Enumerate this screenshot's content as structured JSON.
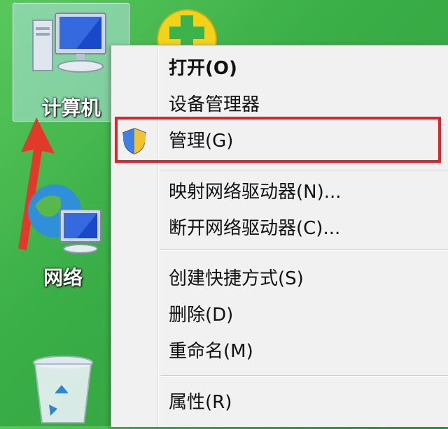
{
  "desktop": {
    "icons": [
      {
        "label": "计算机",
        "icon": "computer-icon"
      },
      {
        "label": "网络",
        "icon": "network-icon"
      },
      {
        "label": "",
        "icon": "recycle-bin-icon"
      }
    ]
  },
  "context_menu": {
    "items": [
      {
        "label": "打开(O)",
        "bold": true
      },
      {
        "label": "设备管理器"
      },
      {
        "label": "管理(G)",
        "icon": "uac-shield-icon",
        "highlighted": true
      },
      {
        "label": "映射网络驱动器(N)..."
      },
      {
        "label": "断开网络驱动器(C)..."
      },
      {
        "label": "创建快捷方式(S)"
      },
      {
        "label": "删除(D)"
      },
      {
        "label": "重命名(M)"
      },
      {
        "label": "属性(R)"
      }
    ]
  },
  "colors": {
    "desktop_green": "#3aae47",
    "highlight_box": "#e0232d",
    "arrow": "#e23a2a"
  }
}
